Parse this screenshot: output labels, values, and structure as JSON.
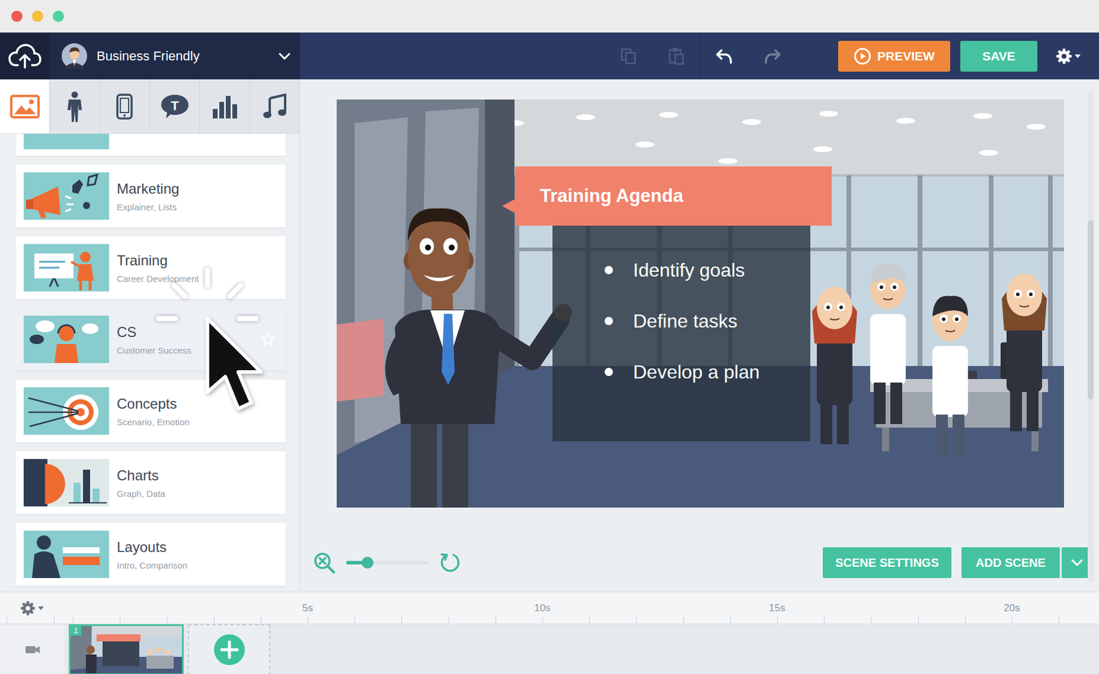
{
  "toolbar": {
    "theme": "Business Friendly",
    "preview": "PREVIEW",
    "save": "SAVE"
  },
  "history": [
    {
      "kind": "copy",
      "disabled": true
    },
    {
      "kind": "paste",
      "disabled": true
    },
    {
      "kind": "undo",
      "disabled": false
    },
    {
      "kind": "redo",
      "disabled": true
    }
  ],
  "asset_tabs": [
    {
      "kind": "backgrounds",
      "selected": true,
      "glyph": ""
    },
    {
      "kind": "characters",
      "selected": false,
      "glyph": ""
    },
    {
      "kind": "devices",
      "selected": false,
      "glyph": ""
    },
    {
      "kind": "text",
      "selected": false,
      "glyph": "T"
    },
    {
      "kind": "charts",
      "selected": false,
      "glyph": ""
    },
    {
      "kind": "audio",
      "selected": false,
      "glyph": ""
    }
  ],
  "categories": [
    {
      "title": "Marketing",
      "subtitle": "Explainer, Lists",
      "kind": "marketing",
      "hovered": false
    },
    {
      "title": "Training",
      "subtitle": "Career Development",
      "kind": "training",
      "hovered": false
    },
    {
      "title": "CS",
      "subtitle": "Customer Success",
      "kind": "support",
      "hovered": true
    },
    {
      "title": "Concepts",
      "subtitle": "Scenario, Emotion",
      "kind": "concepts",
      "hovered": false
    },
    {
      "title": "Charts",
      "subtitle": "Graph, Data",
      "kind": "charts",
      "hovered": false
    },
    {
      "title": "Layouts",
      "subtitle": "Intro, Comparison",
      "kind": "layouts",
      "hovered": false
    }
  ],
  "scene": {
    "title": "Training Agenda",
    "bullets": [
      "Identify goals",
      "Define tasks",
      "Develop a plan"
    ]
  },
  "zoom": {
    "level": 0.26
  },
  "scene_buttons": {
    "settings": "SCENE SETTINGS",
    "add": "ADD SCENE"
  },
  "timeline": {
    "ticks": [
      "5s",
      "10s",
      "15s",
      "20s"
    ],
    "scenes": [
      {
        "number": "1",
        "selected": true
      }
    ]
  }
}
